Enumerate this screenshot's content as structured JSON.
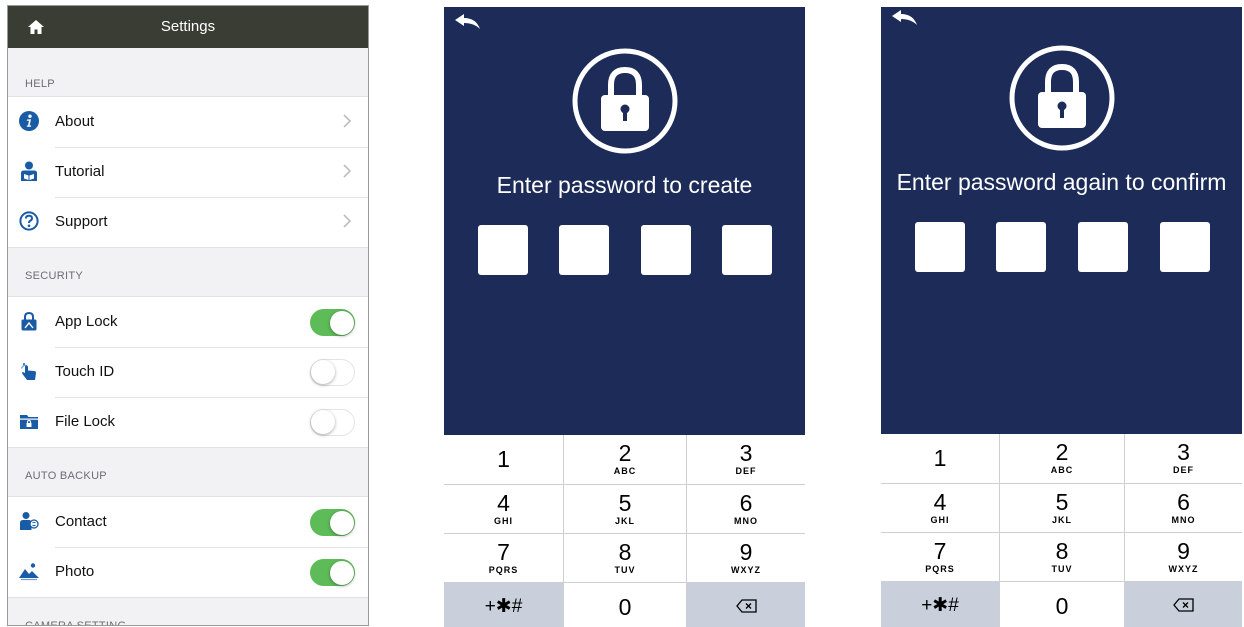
{
  "settings": {
    "title": "Settings",
    "sections": {
      "help": {
        "label": "HELP",
        "items": [
          {
            "label": "About"
          },
          {
            "label": "Tutorial"
          },
          {
            "label": "Support"
          }
        ]
      },
      "security": {
        "label": "SECURITY",
        "items": [
          {
            "label": "App Lock",
            "toggle": "on"
          },
          {
            "label": "Touch ID",
            "toggle": "off"
          },
          {
            "label": "File Lock",
            "toggle": "off"
          }
        ]
      },
      "auto_backup": {
        "label": "AUTO BACKUP",
        "items": [
          {
            "label": "Contact",
            "toggle": "on"
          },
          {
            "label": "Photo",
            "toggle": "on"
          }
        ]
      },
      "camera_setting": {
        "label": "CAMERA SETTING"
      }
    },
    "colors": {
      "header": "#3a3d33",
      "icon_blue": "#1a5ba6",
      "toggle_on": "#5dbb58"
    }
  },
  "create_screen": {
    "prompt": "Enter password to create",
    "background": "#1c2b58"
  },
  "confirm_screen": {
    "prompt": "Enter password again to confirm",
    "background": "#1c2b58"
  },
  "keypad": {
    "keys": [
      {
        "num": "1",
        "letters": ""
      },
      {
        "num": "2",
        "letters": "ABC"
      },
      {
        "num": "3",
        "letters": "DEF"
      },
      {
        "num": "4",
        "letters": "GHI"
      },
      {
        "num": "5",
        "letters": "JKL"
      },
      {
        "num": "6",
        "letters": "MNO"
      },
      {
        "num": "7",
        "letters": "PQRS"
      },
      {
        "num": "8",
        "letters": "TUV"
      },
      {
        "num": "9",
        "letters": "WXYZ"
      }
    ],
    "symbols": "+✱#",
    "zero": "0",
    "delete_icon": "backspace-icon"
  }
}
